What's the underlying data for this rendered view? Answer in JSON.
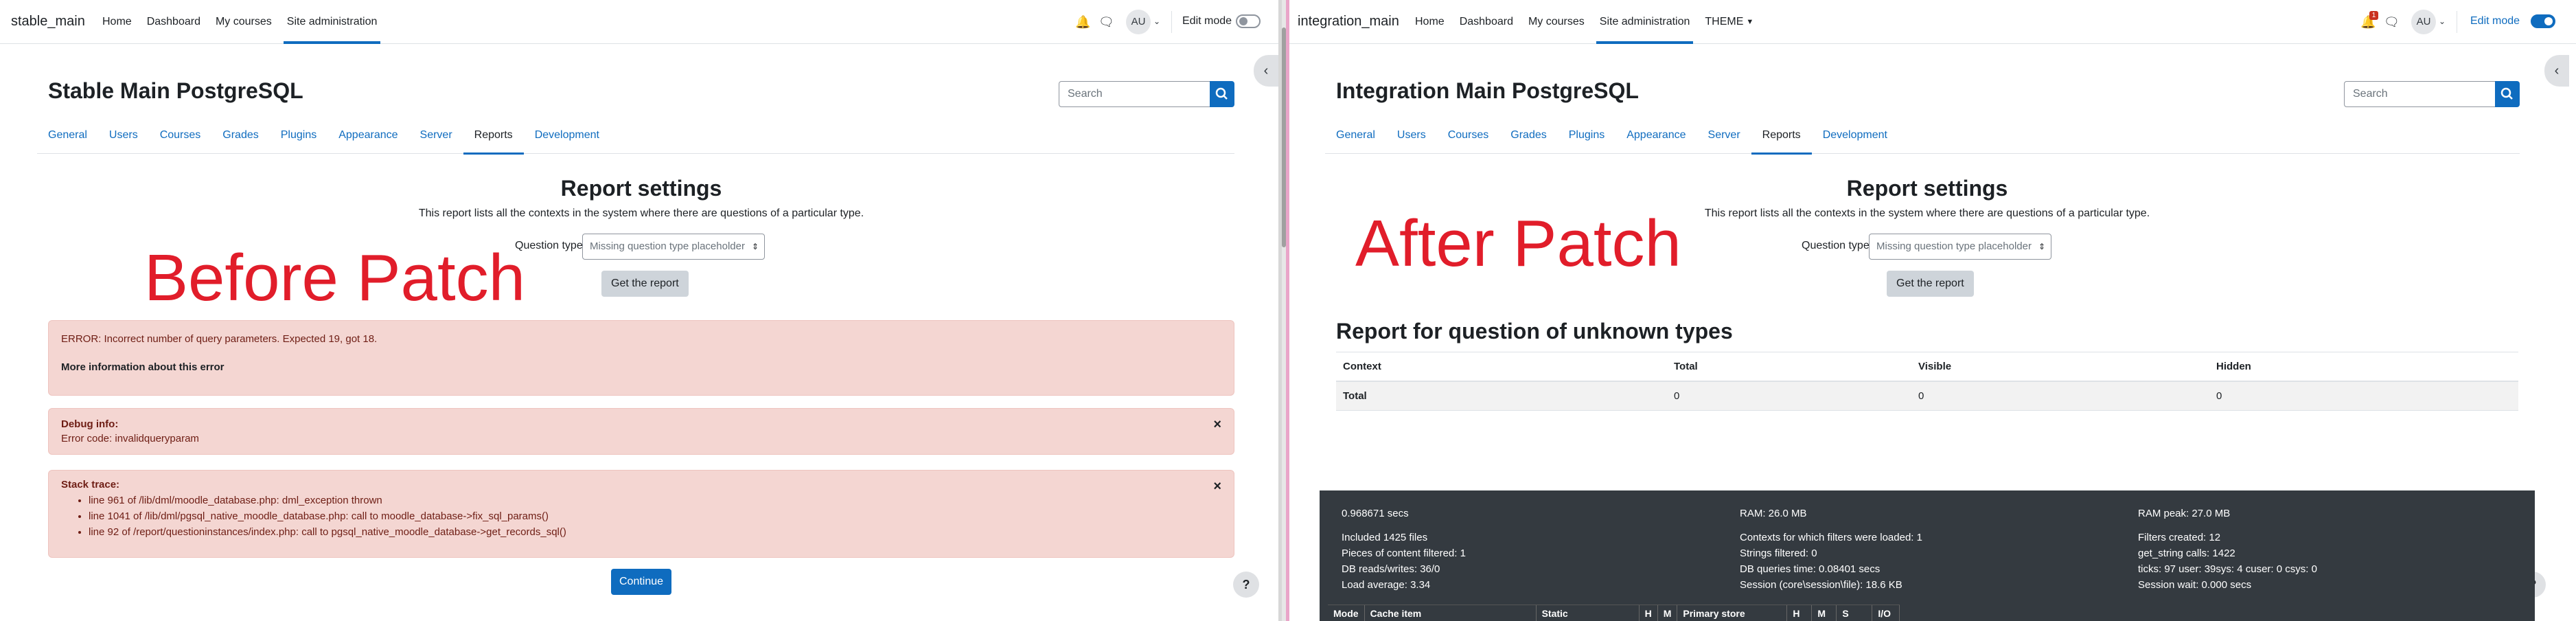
{
  "left": {
    "brand": "stable_main",
    "nav": [
      "Home",
      "Dashboard",
      "My courses",
      "Site administration"
    ],
    "edit_mode": "Edit mode",
    "avatar": "AU",
    "page_title": "Stable Main PostgreSQL",
    "search_placeholder": "Search",
    "tabs": [
      "General",
      "Users",
      "Courses",
      "Grades",
      "Plugins",
      "Appearance",
      "Server",
      "Reports",
      "Development"
    ],
    "report_title": "Report settings",
    "report_desc": "This report lists all the contexts in the system where there are questions of a particular type.",
    "qtype_label": "Question type",
    "qtype_value": "Missing question type placeholder",
    "get_report": "Get the report",
    "overlay": "Before Patch",
    "error": {
      "message": "ERROR: Incorrect number of query parameters. Expected 19, got 18.",
      "more": "More information about this error"
    },
    "debug": {
      "title": "Debug info:",
      "code": "Error code: invalidqueryparam"
    },
    "stack": {
      "title": "Stack trace:",
      "lines": [
        "line 961 of /lib/dml/moodle_database.php: dml_exception thrown",
        "line 1041 of /lib/dml/pgsql_native_moodle_database.php: call to moodle_database->fix_sql_params()",
        "line 92 of /report/questioninstances/index.php: call to pgsql_native_moodle_database->get_records_sql()"
      ]
    },
    "continue": "Continue",
    "help": "?"
  },
  "right": {
    "brand": "integration_main",
    "nav": [
      "Home",
      "Dashboard",
      "My courses",
      "Site administration",
      "THEME"
    ],
    "notification_count": "1",
    "edit_mode": "Edit mode",
    "avatar": "AU",
    "page_title": "Integration Main PostgreSQL",
    "search_placeholder": "Search",
    "tabs": [
      "General",
      "Users",
      "Courses",
      "Grades",
      "Plugins",
      "Appearance",
      "Server",
      "Reports",
      "Development"
    ],
    "report_title": "Report settings",
    "report_desc": "This report lists all the contexts in the system where there are questions of a particular type.",
    "qtype_label": "Question type",
    "qtype_value": "Missing question type placeholder",
    "get_report": "Get the report",
    "overlay": "After Patch",
    "result_heading": "Report for question of unknown types",
    "table": {
      "headers": [
        "Context",
        "Total",
        "Visible",
        "Hidden"
      ],
      "row": [
        "Total",
        "0",
        "0",
        "0"
      ]
    },
    "perf": {
      "col1": [
        "0.968671 secs",
        "",
        "Included 1425 files",
        "Pieces of content filtered: 1",
        "DB reads/writes: 36/0",
        "Load average: 3.34"
      ],
      "col2": [
        "RAM: 26.0 MB",
        "",
        "Contexts for which filters were loaded: 1",
        "Strings filtered: 0",
        "DB queries time: 0.08401 secs",
        "Session (core\\session\\file): 18.6 KB"
      ],
      "col3": [
        "RAM peak: 27.0 MB",
        "",
        "Filters created: 12",
        "get_string calls: 1422",
        "ticks: 97 user: 39sys: 4 cuser: 0 csys: 0",
        "Session wait: 0.000 secs"
      ],
      "cache_headers": [
        "Mode",
        "Cache item",
        "Static",
        "H",
        "M",
        "Primary store",
        "H",
        "M",
        "S",
        "I/O"
      ]
    },
    "help": "?"
  }
}
